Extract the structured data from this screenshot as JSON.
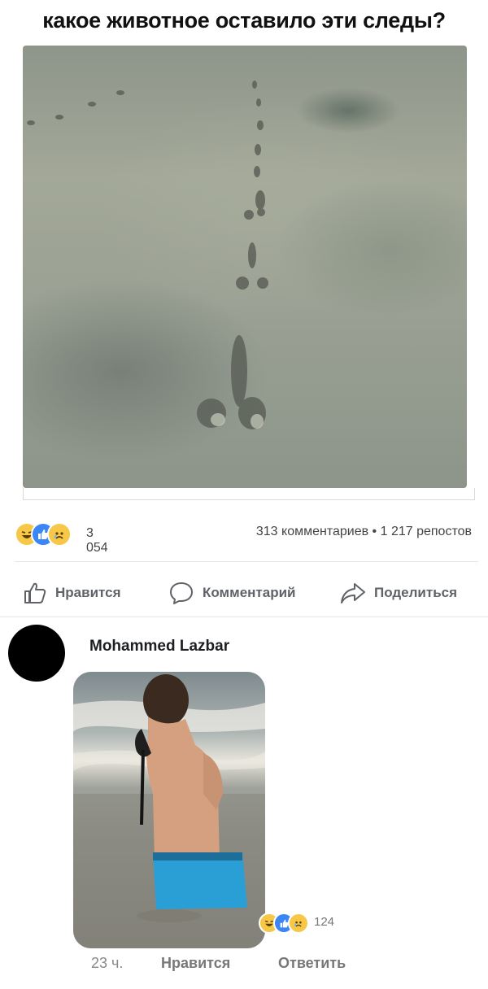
{
  "post": {
    "caption": "какое животное оставило эти следы?"
  },
  "stats": {
    "reaction_icons": [
      "haha-reaction-icon",
      "like-reaction-icon",
      "sad-reaction-icon"
    ],
    "reaction_count": "3 054",
    "comments_shares": "313 комментариев • 1 217 репостов"
  },
  "actions": {
    "like_label": "Нравится",
    "comment_label": "Комментарий",
    "share_label": "Поделиться"
  },
  "comment": {
    "author": "Mohammed Lazbar",
    "reaction_count": "124",
    "time": "23 ч.",
    "like_label": "Нравится",
    "reply_label": "Ответить"
  },
  "colors": {
    "like_blue": "#3b86f4",
    "emoji_yellow": "#f7c847",
    "action_grey": "#5f6368"
  }
}
